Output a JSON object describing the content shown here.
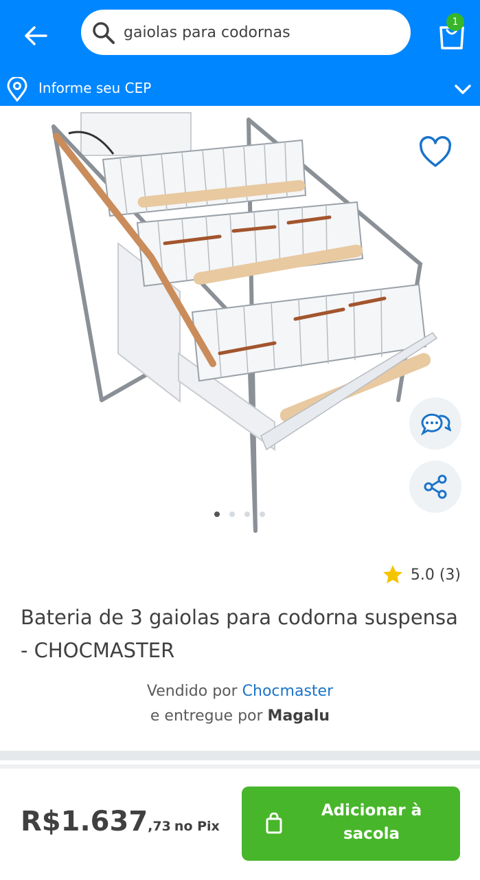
{
  "search": {
    "value": "gaiolas para codornas",
    "placeholder": "gaiolas para codornas"
  },
  "cart": {
    "count": "1"
  },
  "location": {
    "label": "Informe seu CEP"
  },
  "carousel": {
    "total": 4,
    "active": 0
  },
  "product": {
    "rating": "5.0 (3)",
    "title": "Bateria de 3 gaiolas para codorna suspensa - CHOCMASTER",
    "seller_prefix": "Vendido por",
    "seller_name": "Chocmaster",
    "delivery_prefix": "e entregue por",
    "delivery_name": "Magalu"
  },
  "pricing": {
    "main": "R$1.637",
    "cents": ",73",
    "suffix": "no Pix"
  },
  "actions": {
    "add_to_bag": "Adicionar à sacola"
  },
  "colors": {
    "brand": "#0086ff",
    "buy_button": "#48b62a",
    "star": "#f5c400",
    "badge": "#37b629",
    "link": "#1a73c9"
  }
}
